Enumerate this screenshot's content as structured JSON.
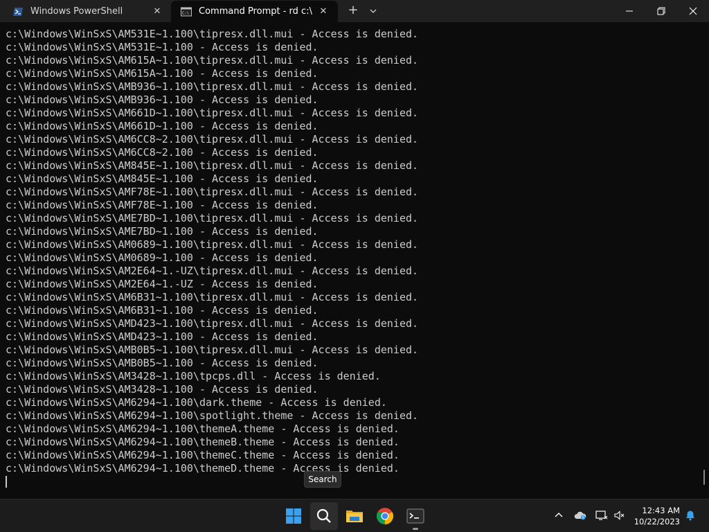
{
  "tabs": [
    {
      "title": "Windows PowerShell",
      "active": false
    },
    {
      "title": "Command Prompt - rd  c:\\ /s /q",
      "active": true
    }
  ],
  "tab_bar": {
    "new_tab": "+",
    "close_glyph": "✕"
  },
  "terminal": {
    "lines": [
      "c:\\Windows\\WinSxS\\AM531E~1.100\\tipresx.dll.mui - Access is denied.",
      "c:\\Windows\\WinSxS\\AM531E~1.100 - Access is denied.",
      "c:\\Windows\\WinSxS\\AM615A~1.100\\tipresx.dll.mui - Access is denied.",
      "c:\\Windows\\WinSxS\\AM615A~1.100 - Access is denied.",
      "c:\\Windows\\WinSxS\\AMB936~1.100\\tipresx.dll.mui - Access is denied.",
      "c:\\Windows\\WinSxS\\AMB936~1.100 - Access is denied.",
      "c:\\Windows\\WinSxS\\AM661D~1.100\\tipresx.dll.mui - Access is denied.",
      "c:\\Windows\\WinSxS\\AM661D~1.100 - Access is denied.",
      "c:\\Windows\\WinSxS\\AM6CC8~2.100\\tipresx.dll.mui - Access is denied.",
      "c:\\Windows\\WinSxS\\AM6CC8~2.100 - Access is denied.",
      "c:\\Windows\\WinSxS\\AM845E~1.100\\tipresx.dll.mui - Access is denied.",
      "c:\\Windows\\WinSxS\\AM845E~1.100 - Access is denied.",
      "c:\\Windows\\WinSxS\\AMF78E~1.100\\tipresx.dll.mui - Access is denied.",
      "c:\\Windows\\WinSxS\\AMF78E~1.100 - Access is denied.",
      "c:\\Windows\\WinSxS\\AME7BD~1.100\\tipresx.dll.mui - Access is denied.",
      "c:\\Windows\\WinSxS\\AME7BD~1.100 - Access is denied.",
      "c:\\Windows\\WinSxS\\AM0689~1.100\\tipresx.dll.mui - Access is denied.",
      "c:\\Windows\\WinSxS\\AM0689~1.100 - Access is denied.",
      "c:\\Windows\\WinSxS\\AM2E64~1.-UZ\\tipresx.dll.mui - Access is denied.",
      "c:\\Windows\\WinSxS\\AM2E64~1.-UZ - Access is denied.",
      "c:\\Windows\\WinSxS\\AM6B31~1.100\\tipresx.dll.mui - Access is denied.",
      "c:\\Windows\\WinSxS\\AM6B31~1.100 - Access is denied.",
      "c:\\Windows\\WinSxS\\AMD423~1.100\\tipresx.dll.mui - Access is denied.",
      "c:\\Windows\\WinSxS\\AMD423~1.100 - Access is denied.",
      "c:\\Windows\\WinSxS\\AMB0B5~1.100\\tipresx.dll.mui - Access is denied.",
      "c:\\Windows\\WinSxS\\AMB0B5~1.100 - Access is denied.",
      "c:\\Windows\\WinSxS\\AM3428~1.100\\tpcps.dll - Access is denied.",
      "c:\\Windows\\WinSxS\\AM3428~1.100 - Access is denied.",
      "c:\\Windows\\WinSxS\\AM6294~1.100\\dark.theme - Access is denied.",
      "c:\\Windows\\WinSxS\\AM6294~1.100\\spotlight.theme - Access is denied.",
      "c:\\Windows\\WinSxS\\AM6294~1.100\\themeA.theme - Access is denied.",
      "c:\\Windows\\WinSxS\\AM6294~1.100\\themeB.theme - Access is denied.",
      "c:\\Windows\\WinSxS\\AM6294~1.100\\themeC.theme - Access is denied.",
      "c:\\Windows\\WinSxS\\AM6294~1.100\\themeD.theme - Access is denied."
    ],
    "text_color": "#cccccc",
    "background": "#0c0c0c"
  },
  "tooltip": {
    "text": "Search"
  },
  "taskbar": {
    "apps": [
      "start-icon",
      "search-icon",
      "file-explorer-icon",
      "chrome-icon",
      "terminal-icon"
    ],
    "clock": {
      "time": "12:43 AM",
      "date": "10/22/2023"
    }
  }
}
